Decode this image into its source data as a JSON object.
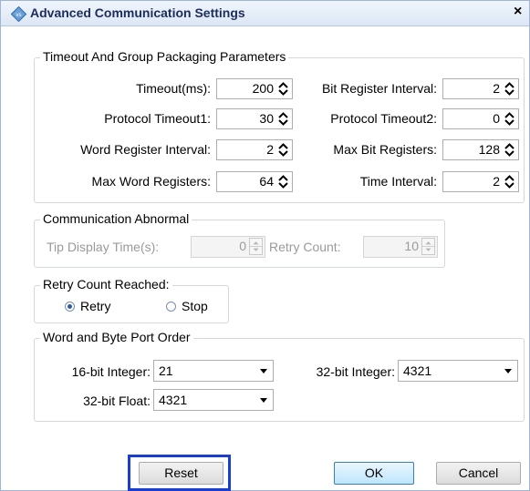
{
  "window": {
    "title": "Advanced Communication Settings",
    "close_symbol": "×"
  },
  "timeout_group": {
    "legend": "Timeout And Group Packaging Parameters",
    "fields": {
      "timeout_ms": {
        "label": "Timeout(ms):",
        "value": "200"
      },
      "bit_register_interval": {
        "label": "Bit Register Interval:",
        "value": "2"
      },
      "protocol_timeout1": {
        "label": "Protocol Timeout1:",
        "value": "30"
      },
      "protocol_timeout2": {
        "label": "Protocol Timeout2:",
        "value": "0"
      },
      "word_register_interval": {
        "label": "Word Register Interval:",
        "value": "2"
      },
      "max_bit_registers": {
        "label": "Max Bit Registers:",
        "value": "128"
      },
      "max_word_registers": {
        "label": "Max Word Registers:",
        "value": "64"
      },
      "time_interval": {
        "label": "Time Interval:",
        "value": "2"
      }
    }
  },
  "comm_abnormal": {
    "legend": "Communication Abnormal",
    "tip_display_time": {
      "label": "Tip Display Time(s):",
      "value": "0"
    },
    "retry_count": {
      "label": "Retry Count:",
      "value": "10"
    }
  },
  "retry_reached": {
    "legend": "Retry Count Reached:",
    "options": [
      {
        "label": "Retry",
        "selected": true
      },
      {
        "label": "Stop",
        "selected": false
      }
    ]
  },
  "port_order": {
    "legend": "Word and Byte Port Order",
    "int16": {
      "label": "16-bit Integer:",
      "value": "21"
    },
    "int32": {
      "label": "32-bit Integer:",
      "value": "4321"
    },
    "float32": {
      "label": "32-bit Float:",
      "value": "4321"
    }
  },
  "buttons": {
    "reset": "Reset",
    "ok": "OK",
    "cancel": "Cancel"
  },
  "colors": {
    "title_text": "#1c2d5a",
    "focus_highlight": "#1a3fd0",
    "default_button": "#3c7fb1"
  }
}
